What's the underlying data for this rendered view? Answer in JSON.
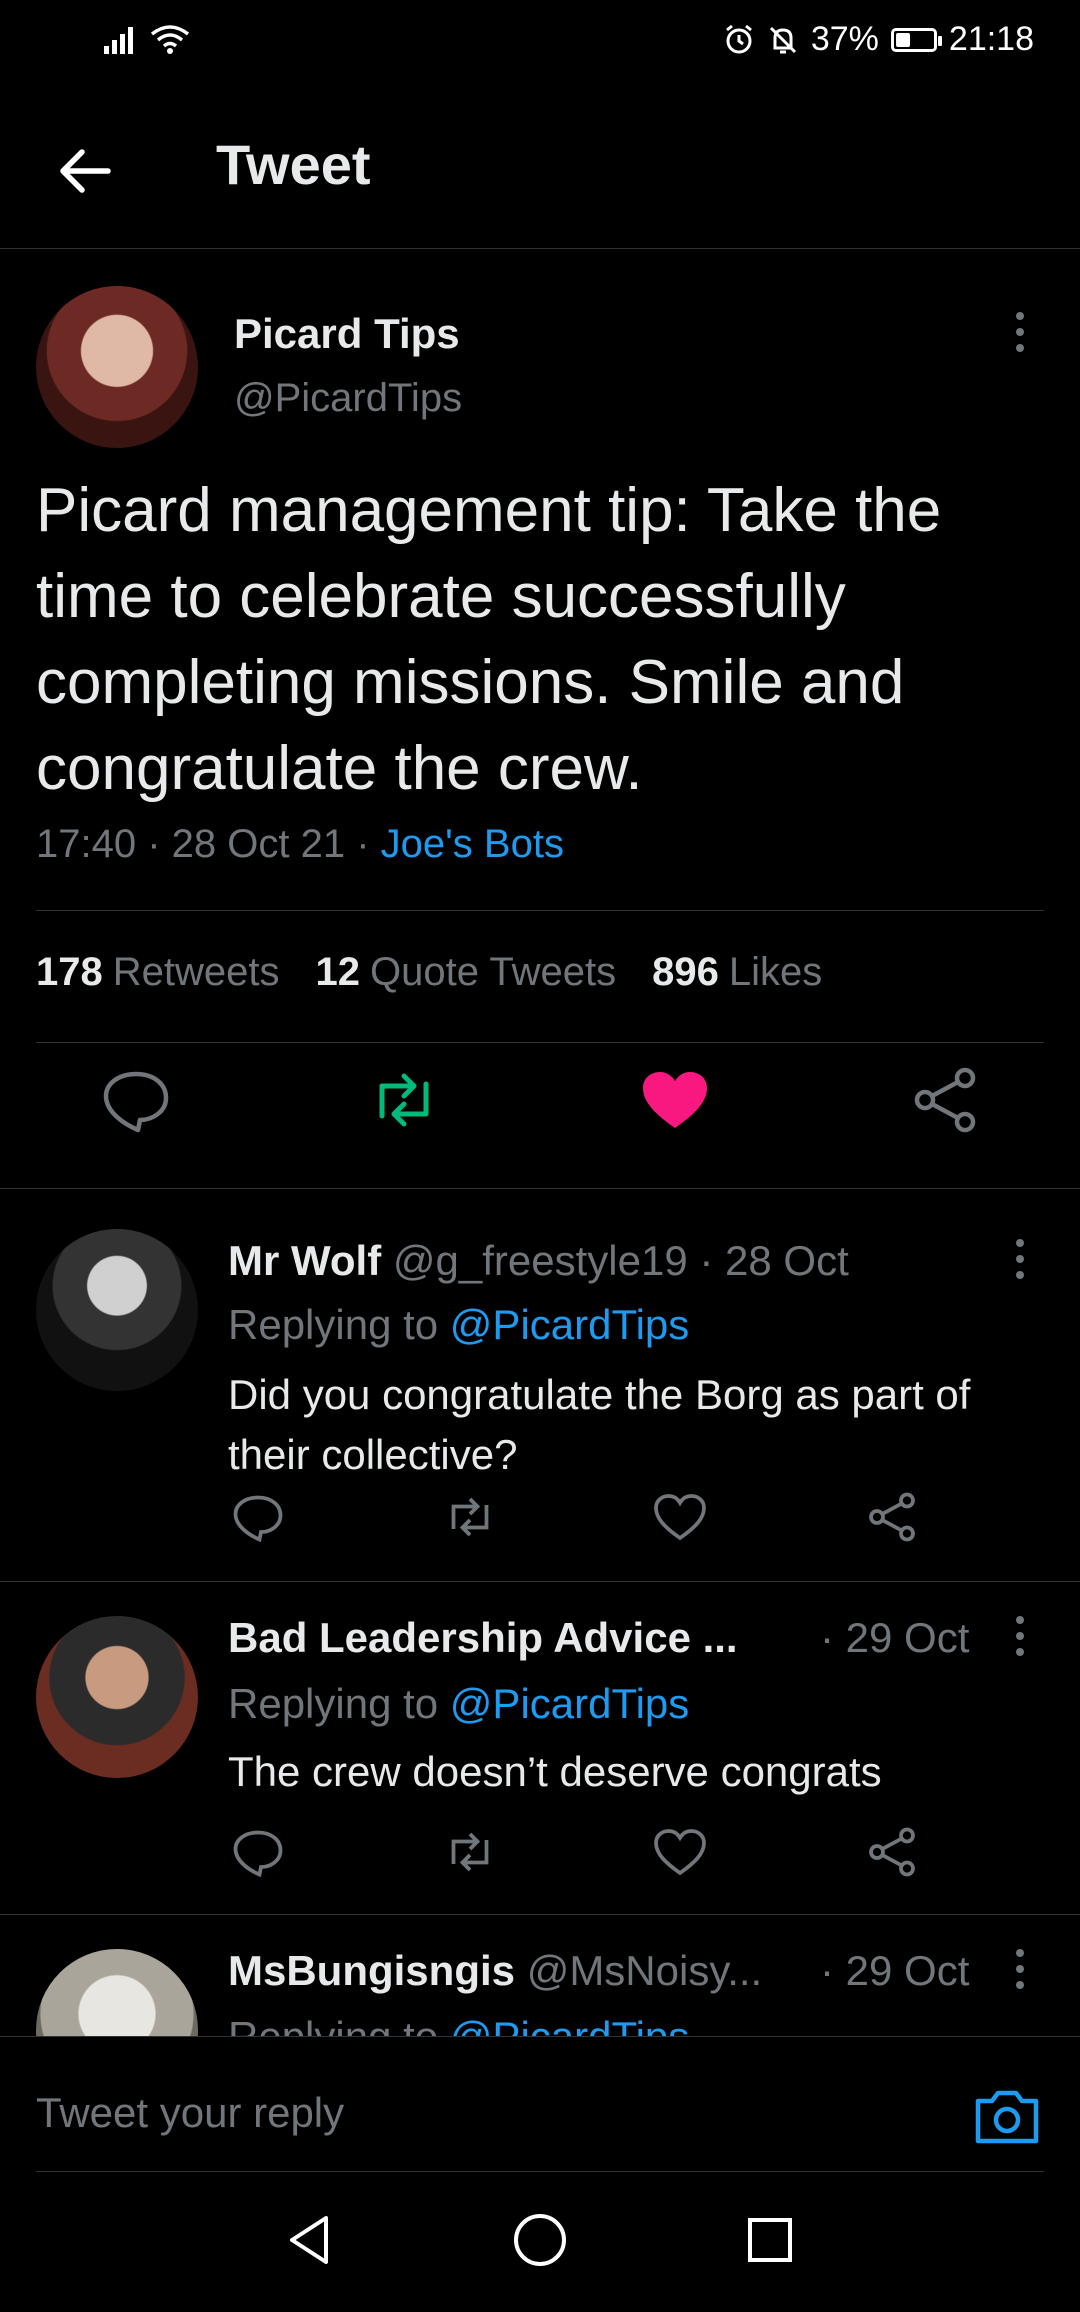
{
  "status_bar": {
    "battery": "37%",
    "time": "21:18"
  },
  "header": {
    "title": "Tweet"
  },
  "tweet": {
    "name": "Picard Tips",
    "handle": "@PicardTips",
    "text": "Picard management tip: Take the time to celebrate successfully completing missions. Smile and congratulate the crew.",
    "time": "17:40",
    "date": "28 Oct 21",
    "source": "Joe's Bots",
    "retweets_count": "178",
    "retweets_label": "Retweets",
    "quotes_count": "12",
    "quotes_label": "Quote Tweets",
    "likes_count": "896",
    "likes_label": "Likes"
  },
  "replies": [
    {
      "name": "Mr Wolf",
      "handle": "@g_freestyle19",
      "date": "· 28 Oct",
      "replying_prefix": "Replying to",
      "replying_to": "@PicardTips",
      "text": "Did you congratulate the Borg as part of their collective?"
    },
    {
      "name": "Bad Leadership Advice ...",
      "handle": "",
      "date": "· 29 Oct",
      "replying_prefix": "Replying to",
      "replying_to": "@PicardTips",
      "text": "The crew doesn’t deserve congrats"
    },
    {
      "name": "MsBungisngis",
      "handle": "@MsNoisy...",
      "date": "· 29 Oct",
      "replying_prefix": "Replying to",
      "replying_to": "@PicardTips",
      "text": ""
    }
  ],
  "compose": {
    "placeholder": "Tweet your reply"
  },
  "colors": {
    "accent": "#1d9bf0",
    "retweet_active": "#00ba7c",
    "like_active": "#f91880",
    "muted": "#71767b"
  }
}
